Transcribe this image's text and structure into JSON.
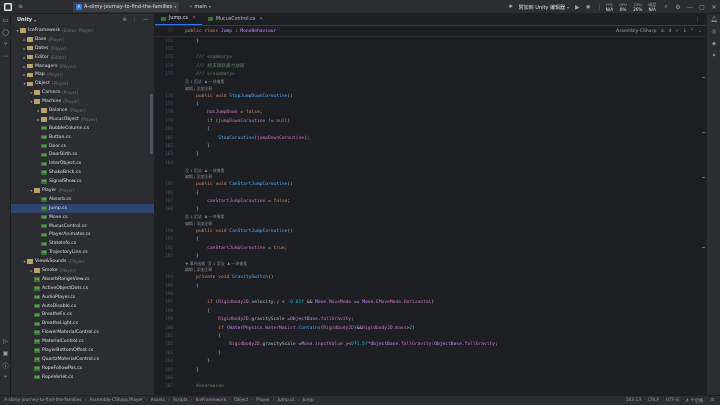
{
  "titlebar": {
    "project_name": "A-slimy-journey-to-find-the-families",
    "branch": "main",
    "unity_label": "附加到 Unity 编辑器",
    "meters": [
      {
        "label": "FPS",
        "value": "N/A"
      },
      {
        "label": "GPU",
        "value": "0%"
      },
      {
        "label": "CPU",
        "value": "26%"
      },
      {
        "label": "磁盘",
        "value": "N/A"
      }
    ]
  },
  "project_panel": {
    "title": "Unity",
    "tree": [
      {
        "depth": 0,
        "type": "folder",
        "label": "IceFramework",
        "tag": "(Editor, Player)",
        "open": true
      },
      {
        "depth": 1,
        "type": "folder",
        "label": "Base",
        "tag": "(Player)",
        "open": false
      },
      {
        "depth": 1,
        "type": "folder",
        "label": "Dates",
        "tag": "(Player)",
        "open": false
      },
      {
        "depth": 1,
        "type": "folder",
        "label": "Editor",
        "tag": "(Editor)",
        "open": false
      },
      {
        "depth": 1,
        "type": "folder",
        "label": "Managers",
        "tag": "(Player)",
        "open": false
      },
      {
        "depth": 1,
        "type": "folder",
        "label": "Map",
        "tag": "(Player)",
        "open": false
      },
      {
        "depth": 1,
        "type": "folder",
        "label": "Object",
        "tag": "(Player)",
        "open": true
      },
      {
        "depth": 2,
        "type": "folder",
        "label": "Camera",
        "tag": "(Player)",
        "open": false
      },
      {
        "depth": 2,
        "type": "folder",
        "label": "Machine",
        "tag": "(Player)",
        "open": true
      },
      {
        "depth": 3,
        "type": "folder",
        "label": "Balance",
        "tag": "(Player)",
        "open": false
      },
      {
        "depth": 3,
        "type": "folder",
        "label": "MucusObject",
        "tag": "(Player)",
        "open": false
      },
      {
        "depth": 3,
        "type": "cs",
        "label": "BubbleColumn.cs",
        "tag": ""
      },
      {
        "depth": 3,
        "type": "cs",
        "label": "Button.cs",
        "tag": ""
      },
      {
        "depth": 3,
        "type": "cs",
        "label": "Door.cs",
        "tag": ""
      },
      {
        "depth": 3,
        "type": "cs",
        "label": "DoorBirth.cs",
        "tag": ""
      },
      {
        "depth": 3,
        "type": "cs",
        "label": "InterObject.cs",
        "tag": ""
      },
      {
        "depth": 3,
        "type": "cs",
        "label": "ShakeBrick.cs",
        "tag": ""
      },
      {
        "depth": 3,
        "type": "cs",
        "label": "SignalShow.cs",
        "tag": ""
      },
      {
        "depth": 2,
        "type": "folder",
        "label": "Player",
        "tag": "(Player)",
        "open": true
      },
      {
        "depth": 3,
        "type": "cs",
        "label": "Absorb.cs",
        "tag": ""
      },
      {
        "depth": 3,
        "type": "cs",
        "label": "Jump.cs",
        "tag": "",
        "selected": true
      },
      {
        "depth": 3,
        "type": "cs",
        "label": "Move.cs",
        "tag": ""
      },
      {
        "depth": 3,
        "type": "cs",
        "label": "MucusControl.cs",
        "tag": ""
      },
      {
        "depth": 3,
        "type": "cs",
        "label": "PlayerAnimator.cs",
        "tag": ""
      },
      {
        "depth": 3,
        "type": "cs",
        "label": "StateInfo.cs",
        "tag": ""
      },
      {
        "depth": 3,
        "type": "cs",
        "label": "TrajectoryLine.cs",
        "tag": ""
      },
      {
        "depth": 1,
        "type": "folder",
        "label": "View&Sounds",
        "tag": "(Player)",
        "open": true
      },
      {
        "depth": 2,
        "type": "folder",
        "label": "Smoke",
        "tag": "(Player)",
        "open": false
      },
      {
        "depth": 2,
        "type": "cs",
        "label": "AbsorbRangeView.cs",
        "tag": ""
      },
      {
        "depth": 2,
        "type": "cs",
        "label": "ActiveObjectDots.cs",
        "tag": ""
      },
      {
        "depth": 2,
        "type": "cs",
        "label": "AudioPlayer.cs",
        "tag": ""
      },
      {
        "depth": 2,
        "type": "cs",
        "label": "AutoDisable.cs",
        "tag": ""
      },
      {
        "depth": 2,
        "type": "cs",
        "label": "BreatheFx.cs",
        "tag": ""
      },
      {
        "depth": 2,
        "type": "cs",
        "label": "BreatheLight.cs",
        "tag": ""
      },
      {
        "depth": 2,
        "type": "cs",
        "label": "FlowerMaterialControl.cs",
        "tag": ""
      },
      {
        "depth": 2,
        "type": "cs",
        "label": "MaterialControl.cs",
        "tag": ""
      },
      {
        "depth": 2,
        "type": "cs",
        "label": "PlayerBottomOffset.cs",
        "tag": ""
      },
      {
        "depth": 2,
        "type": "cs",
        "label": "QuartzMaterialControl.cs",
        "tag": ""
      },
      {
        "depth": 2,
        "type": "cs",
        "label": "RopeFollowPos.cs",
        "tag": ""
      },
      {
        "depth": 2,
        "type": "cs",
        "label": "RopeVerlet.cs",
        "tag": ""
      }
    ]
  },
  "editor": {
    "tabs": [
      {
        "label": "Jump.cs",
        "active": true
      },
      {
        "label": "MucusControl.cs",
        "active": false
      }
    ],
    "sticky_line": {
      "ln": "17",
      "code": "public class Jump : MonoBehaviour"
    },
    "assembly_label": "Assembly-CSharp",
    "warnings": "4",
    "errors": "1"
  },
  "code_lines": [
    {
      "ln": "171",
      "kind": "code",
      "html": "    }"
    },
    {
      "ln": "172",
      "kind": "code",
      "html": ""
    },
    {
      "ln": "173",
      "kind": "code",
      "html": "    <span class='doc'>/// &lt;summary&gt;</span>"
    },
    {
      "ln": "174",
      "kind": "code",
      "html": "    <span class='doc'>/// 结束跳跃蓄力协程</span>"
    },
    {
      "ln": "175",
      "kind": "code",
      "html": "    <span class='doc'>/// &lt;/summary&gt;</span>"
    },
    {
      "ln": "",
      "kind": "hint",
      "html": "没 1 用法  ♟ 一块像素"
    },
    {
      "ln": "",
      "kind": "hint",
      "html": "编辑 | 添加注释"
    },
    {
      "ln": "176",
      "kind": "code",
      "html": "    <span class='kw'>public void</span> <span class='fn'>StopJumpDownCoroutine</span>()"
    },
    {
      "ln": "177",
      "kind": "code",
      "html": "    {"
    },
    {
      "ln": "178",
      "kind": "code",
      "html": "        <span class='fld'>hasJumpDown</span> = <span class='kw'>false</span>;"
    },
    {
      "ln": "179",
      "kind": "code",
      "html": "        <span class='kw'>if</span> (<span class='fld'>jumpDownCoroutine</span> != <span class='kw'>null</span>)"
    },
    {
      "ln": "180",
      "kind": "code",
      "html": "        {"
    },
    {
      "ln": "181",
      "kind": "code",
      "html": "            <span class='fn'>StopCoroutine</span>(<span class='fld'>jumpDownCoroutine</span>);"
    },
    {
      "ln": "182",
      "kind": "code",
      "html": "        }"
    },
    {
      "ln": "183",
      "kind": "code",
      "html": "    }"
    },
    {
      "ln": "184",
      "kind": "code",
      "html": ""
    },
    {
      "ln": "",
      "kind": "hint",
      "html": "没 1 用法  ♟ 一块像素"
    },
    {
      "ln": "",
      "kind": "hint",
      "html": "编辑 | 添加注释"
    },
    {
      "ln": "185",
      "kind": "code",
      "html": "    <span class='kw'>public void</span> <span class='fn'>CanStartJumpCoroutine</span>()"
    },
    {
      "ln": "186",
      "kind": "code",
      "html": "    {"
    },
    {
      "ln": "187",
      "kind": "code",
      "html": "        <span class='fld'>canStartJumpCoroutine</span> = <span class='kw'>false</span>;"
    },
    {
      "ln": "188",
      "kind": "code",
      "html": "    }"
    },
    {
      "ln": "",
      "kind": "hint",
      "html": "没 1 用法  ♟ 一块像素"
    },
    {
      "ln": "",
      "kind": "hint",
      "html": "编辑 | 添加注释"
    },
    {
      "ln": "190",
      "kind": "code",
      "html": "    <span class='kw'>public void</span> <span class='fn'>CanStartJumpCoroutine</span>()"
    },
    {
      "ln": "191",
      "kind": "code",
      "html": "    {"
    },
    {
      "ln": "192",
      "kind": "code",
      "html": "        <span class='fld'>canStartJumpCoroutine</span> = <span class='kw'>true</span>;"
    },
    {
      "ln": "193",
      "kind": "code",
      "html": "    }"
    },
    {
      "ln": "",
      "kind": "hint",
      "html": "♦ 事件函数  没 1 用法  ♟ 一块像素"
    },
    {
      "ln": "",
      "kind": "hint",
      "html": "编辑 | 添加注释"
    },
    {
      "ln": "194",
      "kind": "code",
      "html": "    <span class='kw'>private void</span> <span class='fn'>GravitySwitch</span>()"
    },
    {
      "ln": "195",
      "kind": "code",
      "html": "    {"
    },
    {
      "ln": "196",
      "kind": "code",
      "html": ""
    },
    {
      "ln": "197",
      "kind": "code",
      "html": "        <span class='kw'>if</span> (<span class='fld'>Rigidbody2D</span>.velocity.<span class='fld'>y</span> &lt; <span class='num'>-0.05f</span> &amp;&amp; <span class='ty'>Move</span>.<span class='fld'>MoveMode</span> == <span class='ty'>Move</span>.<span class='fld'>EMoveMode</span>.<span class='fld'>Horizontal</span>)"
    },
    {
      "ln": "198",
      "kind": "code",
      "html": "        {"
    },
    {
      "ln": "199",
      "kind": "code",
      "html": "            <span class='fld'>Rigidbody2D</span>.gravityScale =<span class='ty'>ObjectBase</span>.<span class='fld'>fallGravity</span>;"
    },
    {
      "ln": "200",
      "kind": "code",
      "html": "            <span class='kw'>if</span> (<span class='ty'>WaterPhysics</span>.<span class='fld'>WaterNoList</span>.<span class='fn'>Contains</span>(<span class='fld'>Rigidbody2D</span>)&amp;&amp;<span class='fld'>Rigidbody2D</span>.<span class='fld'>mass</span>&gt;<span class='num'>2</span>)"
    },
    {
      "ln": "201",
      "kind": "code",
      "html": "            {"
    },
    {
      "ln": "202",
      "kind": "code",
      "html": "                <span class='fld'>Rigidbody2D</span>.gravityScale =<span class='ty'>Move</span>.<span class='fld'>inputValue</span>.<span class='fld'>y</span>&lt;<span class='num'>0</span>?<span class='num'>1.5f</span>*<span class='ty'>ObjectBase</span>.<span class='fld'>fallGravity</span>:<span class='ty'>ObjectBase</span>.<span class='fld'>fallGravity</span>;"
    },
    {
      "ln": "203",
      "kind": "code",
      "html": "            }"
    },
    {
      "ln": "204",
      "kind": "code",
      "html": "        }"
    },
    {
      "ln": "205",
      "kind": "code",
      "html": "    }"
    },
    {
      "ln": "206",
      "kind": "code",
      "html": ""
    },
    {
      "ln": "207",
      "kind": "code",
      "html": "    <span class='cm'>#endregion</span>"
    },
    {
      "ln": "208",
      "kind": "code",
      "html": ""
    },
    {
      "ln": "209",
      "kind": "code",
      "html": "}"
    }
  ],
  "statusbar": {
    "crumbs": [
      "A-slimy-journey-to-find-the-families",
      "Assembly-CSharp.Player",
      "Assets",
      "Scripts",
      "IceFramework",
      "Object",
      "Player",
      "Jump.cs",
      "Jump"
    ],
    "position": "163:13",
    "line_ending": "CRLF",
    "encoding": "UTF-8",
    "indent": "4 个空格"
  }
}
